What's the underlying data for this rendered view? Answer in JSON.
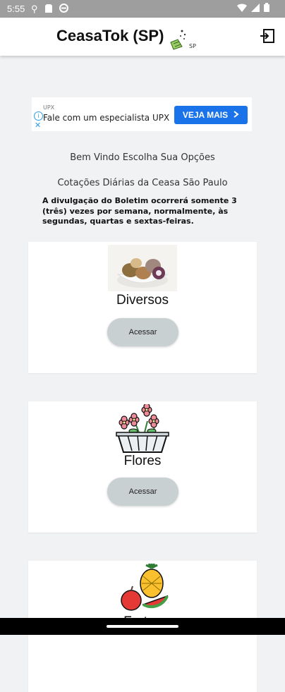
{
  "status_bar": {
    "time": "5:55"
  },
  "app_bar": {
    "title": "CeasaTok (SP)",
    "logo_sub": "SP"
  },
  "ad": {
    "sponsor": "UPX",
    "text": "Fale com um especialista UPX",
    "cta": "VEJA MAIS"
  },
  "welcome": "Bem Vindo Escolha Sua Opções",
  "subtitle": "Cotações Diárias da Ceasa São Paulo",
  "notice": "A divulgação do Boletim ocorrerá somente 3 (três) vezes por semana, normalmente, às segundas, quartas e sextas-feiras.",
  "categories": [
    {
      "title": "Diversos",
      "button": "Acessar"
    },
    {
      "title": "Flores",
      "button": "Acessar"
    },
    {
      "title": "Frutas"
    }
  ]
}
